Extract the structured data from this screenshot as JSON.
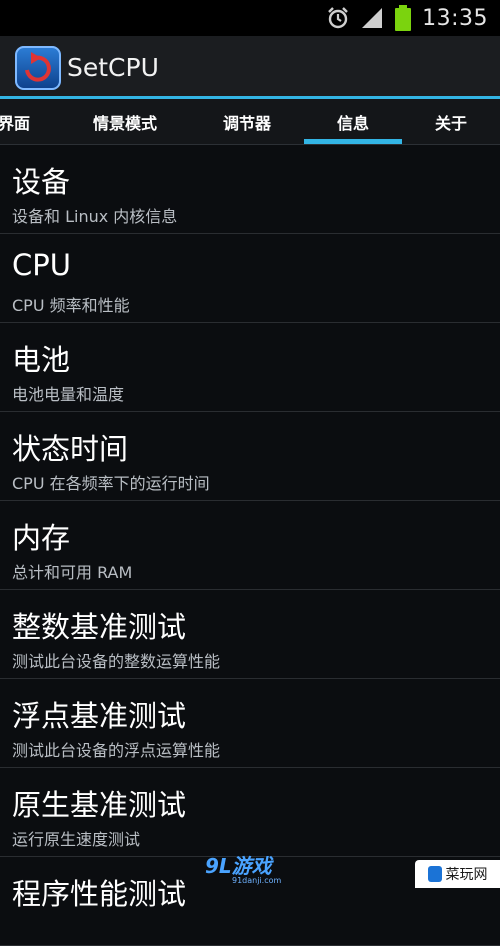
{
  "status_bar": {
    "time": "13:35",
    "icons": [
      "alarm-icon",
      "signal-icon",
      "battery-icon"
    ],
    "colors": {
      "battery": "#7bd30e",
      "signal": "#cfcfcf"
    }
  },
  "app": {
    "title": "SetCPU",
    "accent": "#33b5e5"
  },
  "tabs": [
    {
      "label": "界面",
      "selected": false
    },
    {
      "label": "情景模式",
      "selected": false
    },
    {
      "label": "调节器",
      "selected": false
    },
    {
      "label": "信息",
      "selected": true
    },
    {
      "label": "关于",
      "selected": false
    }
  ],
  "list": [
    {
      "title": "设备",
      "subtitle": "设备和 Linux 内核信息"
    },
    {
      "title": "CPU",
      "subtitle": "CPU 频率和性能"
    },
    {
      "title": "电池",
      "subtitle": "电池电量和温度"
    },
    {
      "title": "状态时间",
      "subtitle": "CPU 在各频率下的运行时间"
    },
    {
      "title": "内存",
      "subtitle": "总计和可用 RAM"
    },
    {
      "title": "整数基准测试",
      "subtitle": "测试此台设备的整数运算性能"
    },
    {
      "title": "浮点基准测试",
      "subtitle": "测试此台设备的浮点运算性能"
    },
    {
      "title": "原生基准测试",
      "subtitle": "运行原生速度测试"
    },
    {
      "title": "程序性能测试",
      "subtitle": ""
    }
  ],
  "watermark": {
    "logo_text": "9L游戏",
    "url": "91danji.com",
    "badge_text": "菜玩网"
  }
}
